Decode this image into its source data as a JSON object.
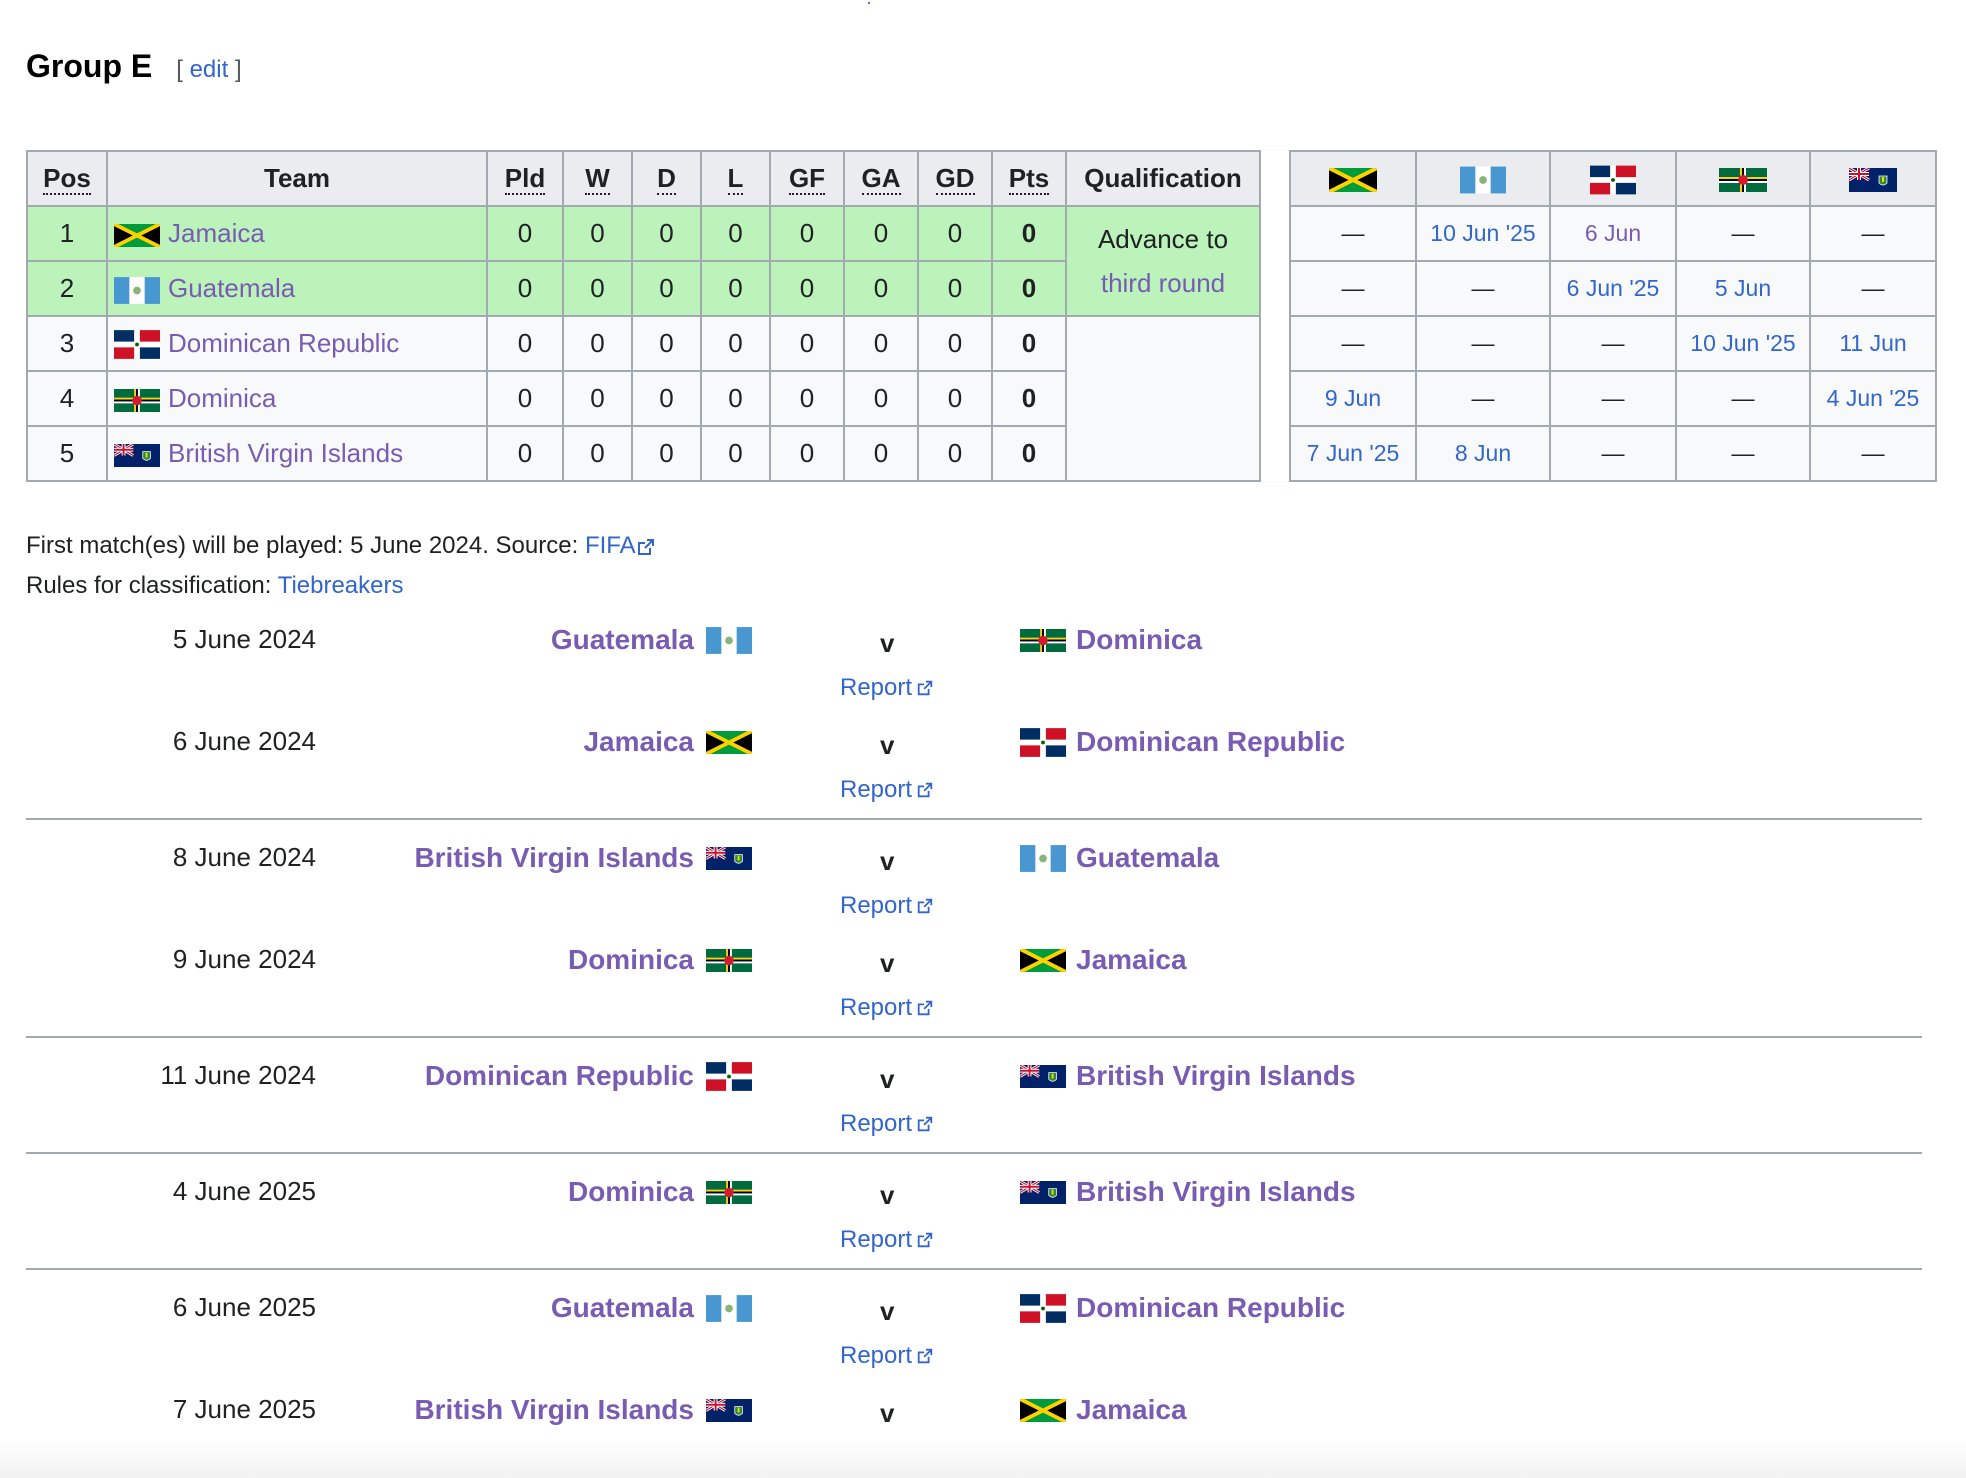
{
  "heading": {
    "title": "Group E",
    "edit_open": "[",
    "edit_label": "edit",
    "edit_close": "]"
  },
  "table": {
    "headers": {
      "pos": "Pos",
      "team": "Team",
      "pld": "Pld",
      "w": "W",
      "d": "D",
      "l": "L",
      "gf": "GF",
      "ga": "GA",
      "gd": "GD",
      "pts": "Pts",
      "qualification": "Qualification"
    },
    "qualification_line1": "Advance to",
    "qualification_line2": "third round",
    "rows": [
      {
        "pos": "1",
        "team": "Jamaica",
        "flag": "jamaica-flag",
        "pld": "0",
        "w": "0",
        "d": "0",
        "l": "0",
        "gf": "0",
        "ga": "0",
        "gd": "0",
        "pts": "0",
        "results": [
          "—",
          "10 Jun '25",
          "6 Jun",
          "—",
          "—"
        ]
      },
      {
        "pos": "2",
        "team": "Guatemala",
        "flag": "guatemala-flag",
        "pld": "0",
        "w": "0",
        "d": "0",
        "l": "0",
        "gf": "0",
        "ga": "0",
        "gd": "0",
        "pts": "0",
        "results": [
          "—",
          "—",
          "6 Jun '25",
          "5 Jun",
          "—"
        ]
      },
      {
        "pos": "3",
        "team": "Dominican Republic",
        "flag": "dominican-republic-flag",
        "pld": "0",
        "w": "0",
        "d": "0",
        "l": "0",
        "gf": "0",
        "ga": "0",
        "gd": "0",
        "pts": "0",
        "results": [
          "—",
          "—",
          "—",
          "10 Jun '25",
          "11 Jun"
        ]
      },
      {
        "pos": "4",
        "team": "Dominica",
        "flag": "dominica-flag",
        "pld": "0",
        "w": "0",
        "d": "0",
        "l": "0",
        "gf": "0",
        "ga": "0",
        "gd": "0",
        "pts": "0",
        "results": [
          "9 Jun",
          "—",
          "—",
          "—",
          "4 Jun '25"
        ]
      },
      {
        "pos": "5",
        "team": "British Virgin Islands",
        "flag": "british-virgin-islands-flag",
        "pld": "0",
        "w": "0",
        "d": "0",
        "l": "0",
        "gf": "0",
        "ga": "0",
        "gd": "0",
        "pts": "0",
        "results": [
          "7 Jun '25",
          "8 Jun",
          "—",
          "—",
          "—"
        ]
      }
    ]
  },
  "notes": {
    "first_match_prefix": "First match(es) will be played: 5 June 2024. Source: ",
    "source_link": "FIFA",
    "rules_prefix": "Rules for classification: ",
    "rules_link": "Tiebreakers"
  },
  "matches": [
    {
      "date": "5 June 2024",
      "home": "Guatemala",
      "away": "Dominica",
      "v": "v",
      "report": "Report"
    },
    {
      "date": "6 June 2024",
      "home": "Jamaica",
      "away": "Dominican Republic",
      "v": "v",
      "report": "Report"
    },
    {
      "date": "8 June 2024",
      "home": "British Virgin Islands",
      "away": "Guatemala",
      "v": "v",
      "report": "Report"
    },
    {
      "date": "9 June 2024",
      "home": "Dominica",
      "away": "Jamaica",
      "v": "v",
      "report": "Report"
    },
    {
      "date": "11 June 2024",
      "home": "Dominican Republic",
      "away": "British Virgin Islands",
      "v": "v",
      "report": "Report"
    },
    {
      "date": "4 June 2025",
      "home": "Dominica",
      "away": "British Virgin Islands",
      "v": "v",
      "report": "Report"
    },
    {
      "date": "6 June 2025",
      "home": "Guatemala",
      "away": "Dominican Republic",
      "v": "v",
      "report": "Report"
    },
    {
      "date": "7 June 2025",
      "home": "British Virgin Islands",
      "away": "Jamaica",
      "v": "v",
      "report": "Report"
    }
  ],
  "colors": {
    "link": "#3366cc",
    "visited": "#795cb2",
    "advance": "#bbf3bb",
    "header": "#eaecf0",
    "border": "#a2a9b1"
  }
}
